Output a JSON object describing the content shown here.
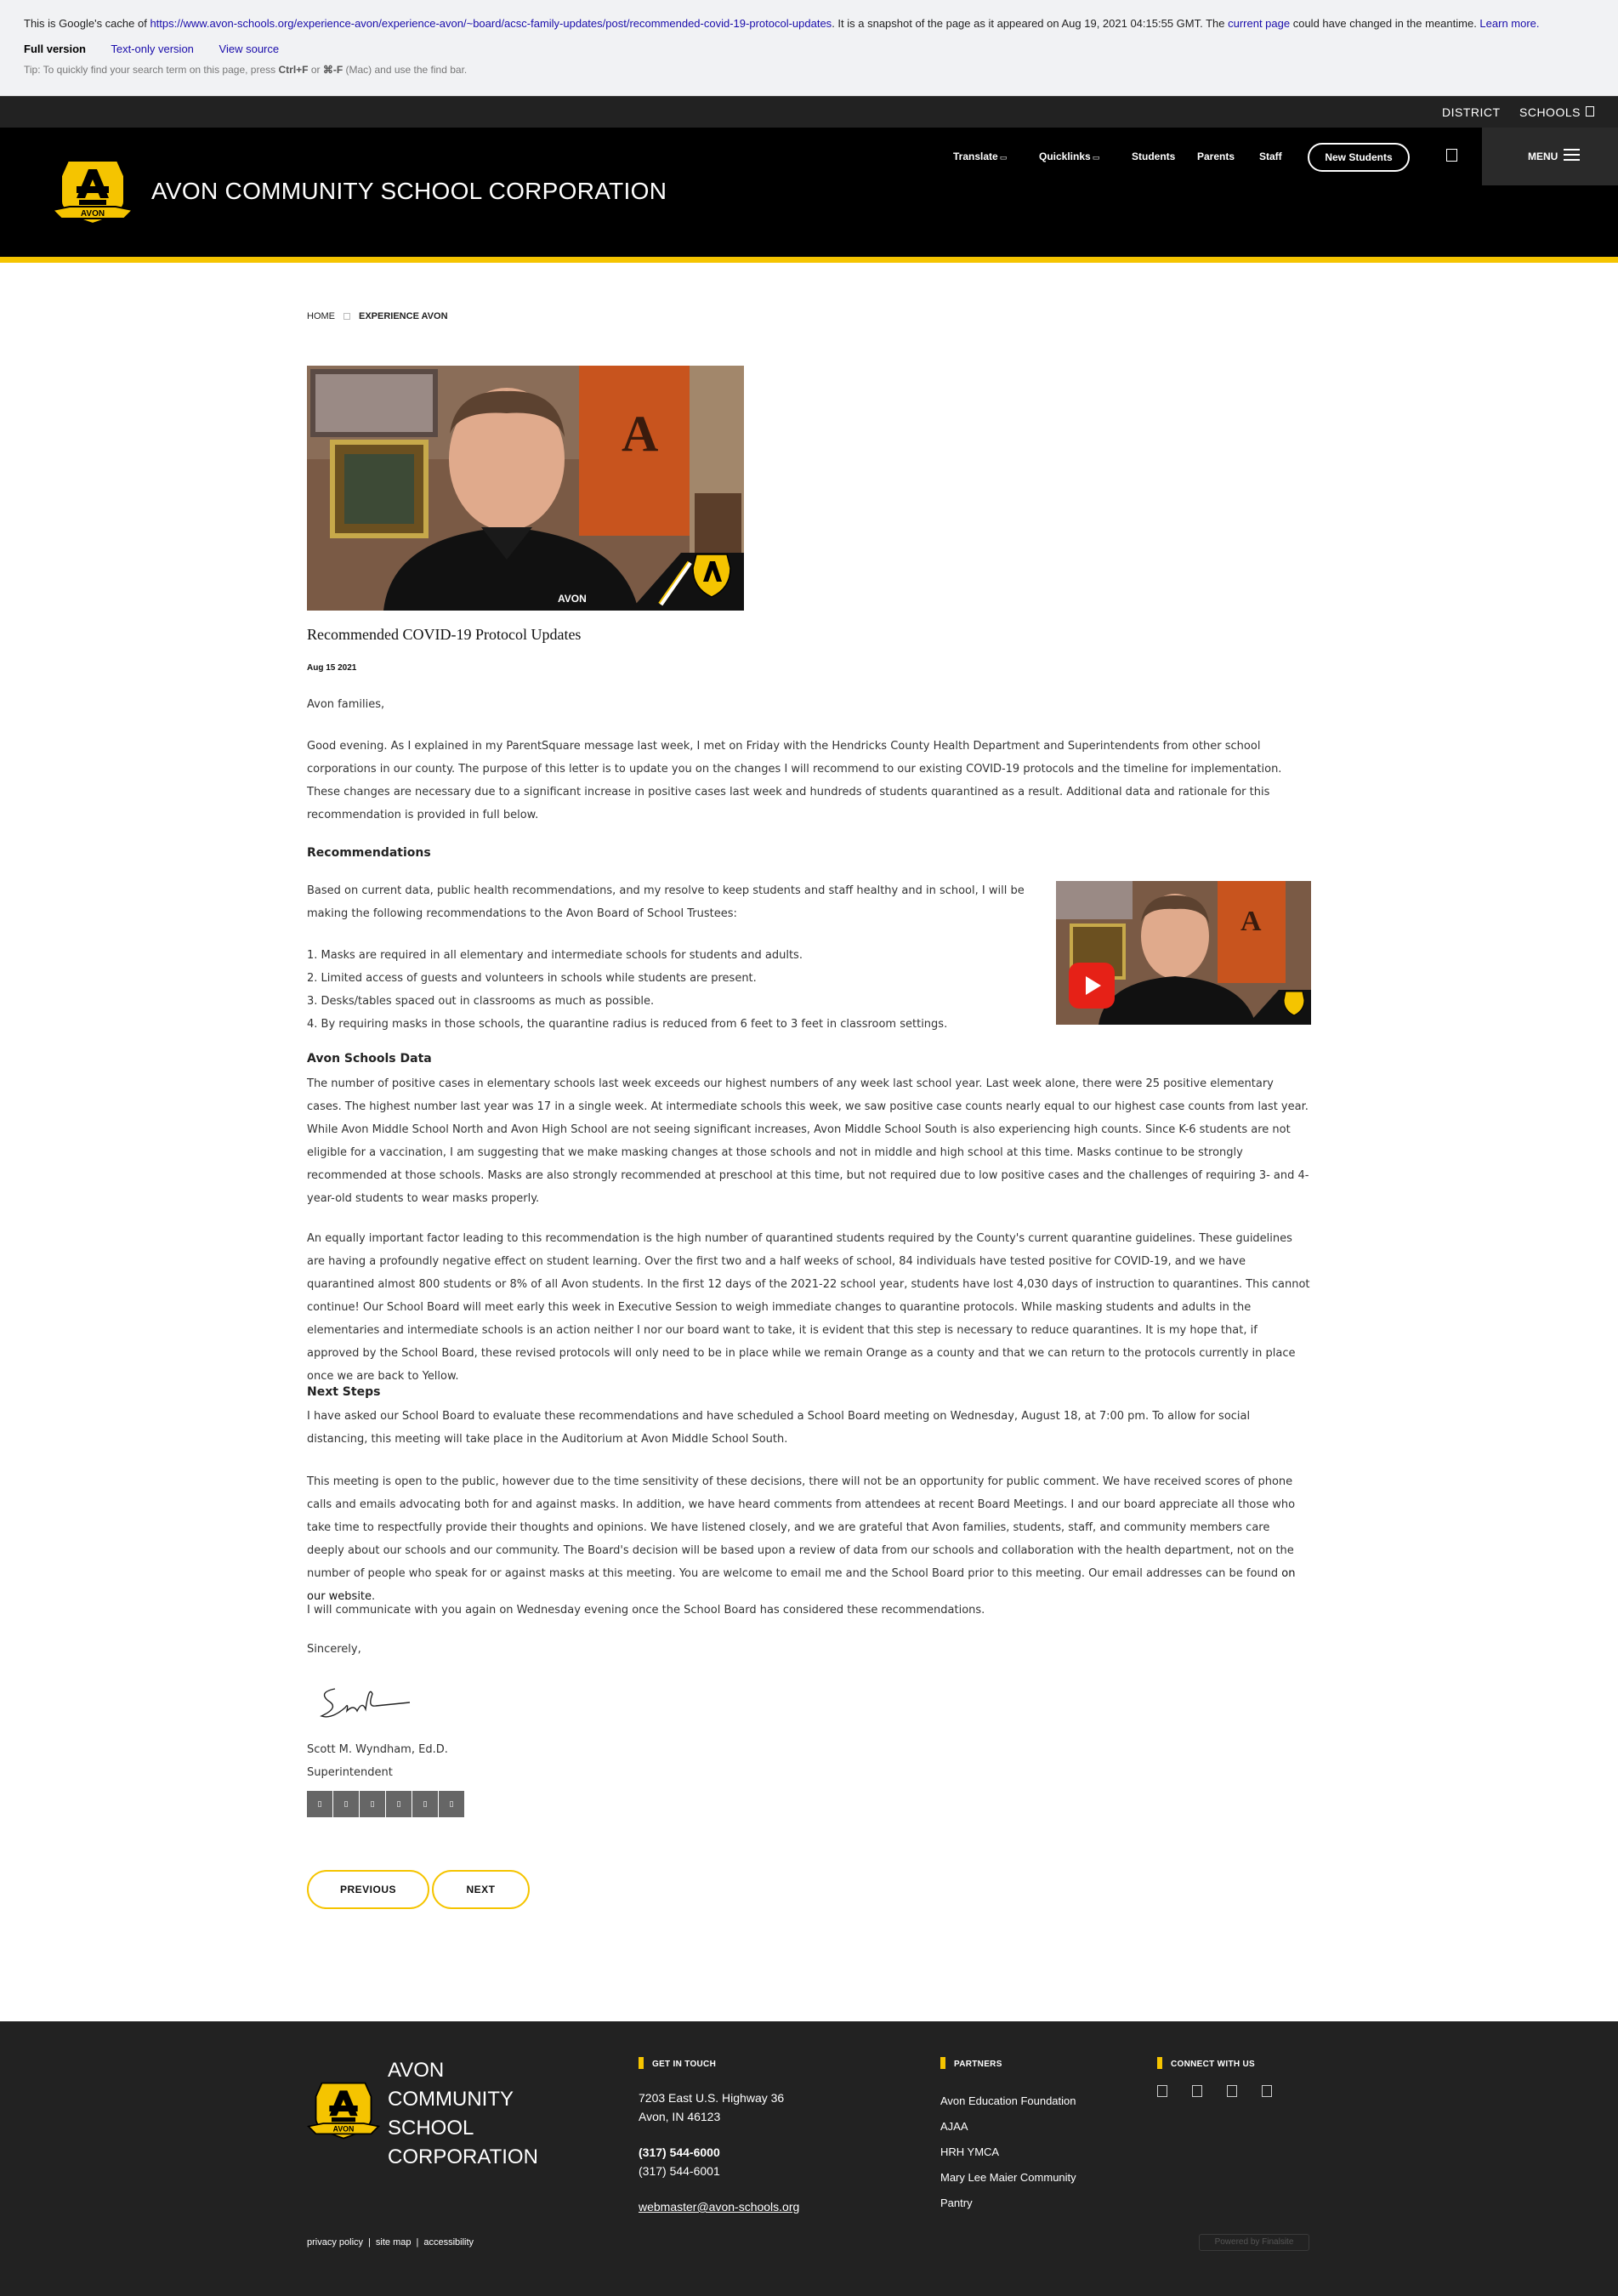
{
  "cache_banner": {
    "prefix": "This is Google's cache of ",
    "url": "https://www.avon-schools.org/experience-avon/experience-avon/~board/acsc-family-updates/post/recommended-covid-19-protocol-updates",
    "middle": ". It is a snapshot of the page as it appeared on Aug 19, 2021 04:15:55 GMT. The ",
    "current_page": "current page",
    "suffix": " could have changed in the meantime. ",
    "learn_more": "Learn more.",
    "full_version": "Full version",
    "text_only": "Text-only version",
    "view_source": "View source",
    "tip_prefix": "Tip: To quickly find your search term on this page, press ",
    "tip_keys": "Ctrl+F",
    "tip_or": " or ",
    "tip_mac": "⌘-F",
    "tip_suffix": " (Mac) and use the find bar."
  },
  "top_strip": {
    "district": "DISTRICT",
    "schools": "SCHOOLS"
  },
  "header": {
    "title": "AVON COMMUNITY SCHOOL CORPORATION",
    "logo_text": "AVON",
    "nav": {
      "translate": "Translate",
      "quicklinks": "Quicklinks",
      "students": "Students",
      "parents": "Parents",
      "staff": "Staff"
    },
    "new_students": "New Students",
    "menu": "MENU"
  },
  "breadcrumb": {
    "home": "HOME",
    "current": "EXPERIENCE AVON"
  },
  "post": {
    "title": "Recommended COVID-19 Protocol Updates",
    "date": "Aug 15 2021",
    "greeting": "Avon families,",
    "intro": "Good evening. As I explained in my ParentSquare message last week, I met on Friday with the Hendricks County Health Department and Superintendents from other school corporations in our county. The purpose of this letter is to update you on the changes I will recommend to our existing COVID-19 protocols and the timeline for implementation. These changes are necessary due to a significant increase in positive cases last week and hundreds of students quarantined as a result. Additional data and rationale for this recommendation is provided in full below.",
    "recommendations_heading": "Recommendations",
    "recommendations_intro": "Based on current data, public health recommendations, and my resolve to keep students and staff healthy and in school, I will be making the following recommendations to the Avon Board of School Trustees:",
    "list": [
      "Masks are required in all elementary and intermediate schools for students and adults.",
      "Limited access of guests and volunteers in schools while students are present.",
      "Desks/tables spaced out in classrooms as much as possible.",
      "By requiring masks in those schools, the quarantine radius is reduced from 6 feet to 3 feet in classroom settings."
    ],
    "data_heading": "Avon Schools Data",
    "data_p1": "The number of positive cases in elementary schools last week exceeds our highest numbers of any week last school year. Last week alone, there were 25 positive elementary cases. The highest number last year was 17 in a single week. At intermediate schools this week, we saw positive case counts nearly equal to our highest case counts from last year. While Avon Middle School North and Avon High School are not seeing significant increases, Avon Middle School South is also experiencing high counts. Since K-6 students are not eligible for a vaccination, I am suggesting that we make masking changes at those schools and not in middle and high school at this time. Masks continue to be strongly recommended at those schools. Masks are also strongly recommended at preschool at this time, but not required due to low positive cases and the challenges of requiring 3- and 4-year-old students to wear masks properly.",
    "data_p2": "An equally important factor leading to this recommendation is the high number of quarantined students required by the County's current quarantine guidelines. These guidelines are having a profoundly negative effect on student learning. Over the first two and a half weeks of school, 84 individuals have tested positive for COVID-19, and we have quarantined almost 800 students or 8% of all Avon students.  In the first 12 days of the 2021-22 school year, students have lost 4,030 days of instruction to quarantines. This cannot continue! Our School Board will meet early this week in Executive Session to weigh immediate changes to quarantine protocols. While masking students and adults in the elementaries and intermediate schools is an action neither I nor our board want to take, it is evident that this step is necessary to reduce quarantines. It is my hope that, if approved by the School Board, these revised protocols will only need to be in place while we remain Orange as a county and that we can return to the protocols currently in place once we are back to Yellow.",
    "next_heading": "Next Steps",
    "next_p1": "I have asked our School Board to evaluate these recommendations and have scheduled a School Board meeting on Wednesday, August 18, at 7:00 pm. To allow for social distancing, this meeting will take place in the Auditorium at Avon Middle School South.",
    "next_p2": "This meeting is open to the public, however due to the time sensitivity of these decisions, there will not be an opportunity for public comment. We have received scores of phone calls and emails advocating both for and against masks. In addition, we have heard comments from attendees at recent Board Meetings. I and our board appreciate all those who take time to respectfully provide their thoughts and opinions. We have listened closely, and we are grateful that Avon families, students, staff, and community members care deeply about our schools and our community. The Board's decision will be based upon a review of data from our schools and collaboration with the health department, not on the number of people who speak for or against masks at this meeting. You are welcome to email me and the School Board prior to this meeting. Our email addresses can be found ",
    "next_p2_link": "on our website",
    "next_p2_end": ".",
    "closing_line": "I will communicate with you again on Wednesday evening once the School Board has considered these recommendations.",
    "sincerely": "Sincerely,",
    "signer_name": "Scott M. Wyndham, Ed.D.",
    "signer_title": "Superintendent"
  },
  "pager": {
    "previous": "PREVIOUS",
    "next": "NEXT"
  },
  "footer": {
    "name": "AVON COMMUNITY SCHOOL CORPORATION",
    "get_in_touch": "GET IN TOUCH",
    "address1": "7203 East U.S. Highway 36",
    "address2": "Avon, IN  46123",
    "phone": "(317) 544-6000",
    "fax": "(317) 544-6001",
    "email": "webmaster@avon-schools.org",
    "partners_heading": "PARTNERS",
    "partners": [
      "Avon Education Foundation",
      "AJAA",
      "HRH YMCA",
      "Mary Lee Maier Community",
      "Pantry"
    ],
    "connect_heading": "CONNECT WITH US",
    "privacy": "privacy policy",
    "sitemap": "site map",
    "accessibility": "accessibility",
    "powered": "Powered by Finalsite"
  },
  "colors": {
    "accent_yellow": "#f5c400",
    "header_black": "#000000",
    "footer_dark": "#222222",
    "youtube_red": "#e62117"
  }
}
